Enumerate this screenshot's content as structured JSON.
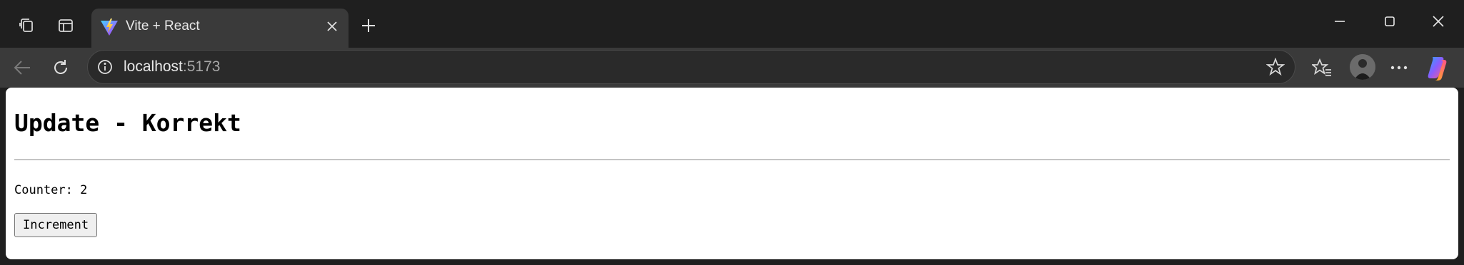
{
  "browser": {
    "tab": {
      "title": "Vite + React"
    },
    "address": {
      "host": "localhost",
      "port": ":5173"
    },
    "window_controls": [
      "minimize",
      "maximize",
      "close"
    ]
  },
  "page": {
    "heading": "Update - Korrekt",
    "counter_text": "Counter: 2",
    "button_label": "Increment"
  },
  "colors": {
    "frame": "#1f1f1f",
    "toolbar": "#3a3a3a",
    "omnibox": "#2a2a2a",
    "page_bg": "#ffffff"
  }
}
